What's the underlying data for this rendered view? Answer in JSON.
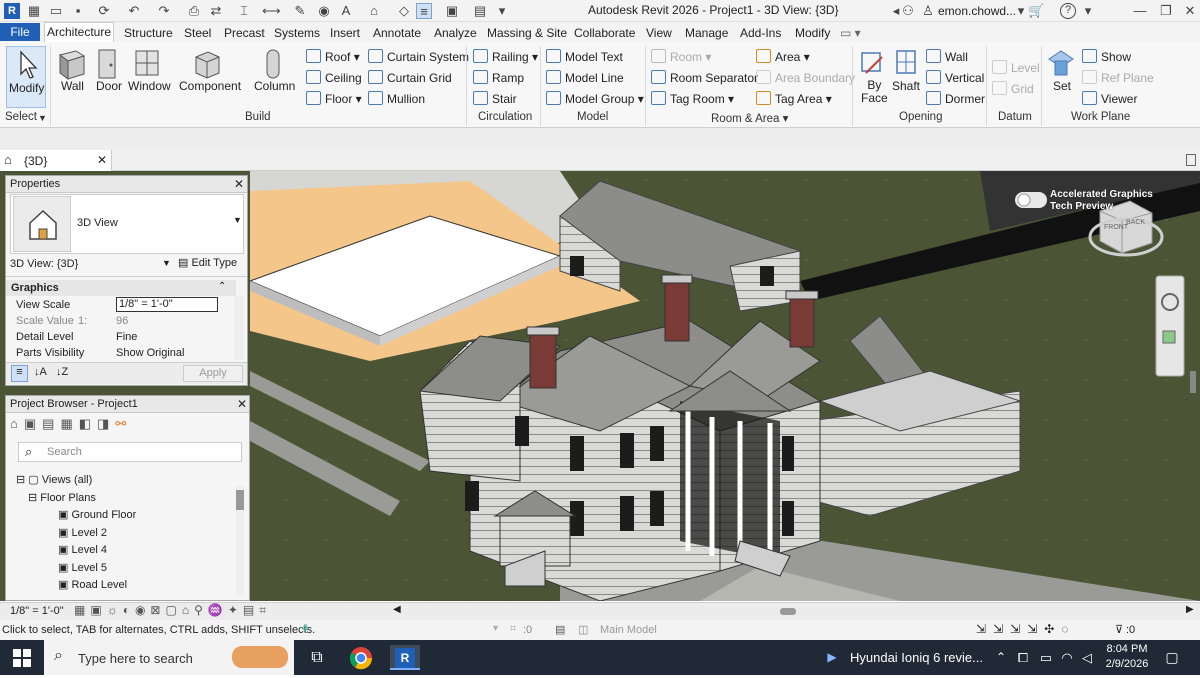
{
  "app": {
    "title": "Autodesk Revit 2026 - Project1 - 3D View: {3D}",
    "user": "emon.chowd...",
    "help": "?"
  },
  "ribbon_tabs": [
    "File",
    "Architecture",
    "Structure",
    "Steel",
    "Precast",
    "Systems",
    "Insert",
    "Annotate",
    "Analyze",
    "Massing & Site",
    "Collaborate",
    "View",
    "Manage",
    "Add-Ins",
    "Modify"
  ],
  "ribbon": {
    "select": {
      "modify": "Modify",
      "label": "Select"
    },
    "build": {
      "label": "Build",
      "big": [
        "Wall",
        "Door",
        "Window",
        "Component",
        "Column"
      ],
      "col1": [
        "Roof",
        "Ceiling",
        "Floor"
      ],
      "col2": [
        "Curtain System",
        "Curtain Grid",
        "Mullion"
      ]
    },
    "circulation": {
      "label": "Circulation",
      "items": [
        "Railing",
        "Ramp",
        "Stair"
      ]
    },
    "model": {
      "label": "Model",
      "items": [
        "Model Text",
        "Model Line",
        "Model Group"
      ]
    },
    "room_area": {
      "label": "Room & Area",
      "col1": [
        "Room",
        "Room Separator",
        "Tag Room"
      ],
      "col2": [
        "Area",
        "Area Boundary",
        "Tag Area"
      ]
    },
    "opening": {
      "label": "Opening",
      "by_face": "By Face",
      "shaft": "Shaft",
      "items": [
        "Wall",
        "Vertical",
        "Dormer"
      ]
    },
    "datum": {
      "label": "Datum",
      "items": [
        "Level",
        "Grid"
      ]
    },
    "work_plane": {
      "label": "Work Plane",
      "set": "Set",
      "items": [
        "Show",
        "Ref Plane",
        "Viewer"
      ]
    }
  },
  "view_tab": {
    "label": "{3D}"
  },
  "properties": {
    "title": "Properties",
    "type_name": "3D View",
    "selector": "3D View: {3D}",
    "edit_type": "Edit Type",
    "section": "Graphics",
    "rows": [
      {
        "name": "View Scale",
        "value": "1/8\" = 1'-0\""
      },
      {
        "name": "Scale Value",
        "value": "96",
        "prefix": "1:"
      },
      {
        "name": "Detail Level",
        "value": "Fine"
      },
      {
        "name": "Parts Visibility",
        "value": "Show Original"
      }
    ],
    "apply": "Apply"
  },
  "project_browser": {
    "title": "Project Browser - Project1",
    "search_placeholder": "Search",
    "root": "Views (all)",
    "group": "Floor Plans",
    "items": [
      "Ground Floor",
      "Level 2",
      "Level 4",
      "Level 5",
      "Road Level"
    ]
  },
  "viewport": {
    "toggle_label": "Accelerated Graphics\nTech Preview",
    "viewcube_front": "FRONT",
    "viewcube_back": "BACK"
  },
  "status": {
    "scale": "1/8\" = 1'-0\"",
    "hint": "Click to select, TAB for alternates, CTRL adds, SHIFT unselects.",
    "selected_count": ":0",
    "model": "Main Model",
    "filter_count": ":0"
  },
  "taskbar": {
    "search_placeholder": "Type here to search",
    "media": "Hyundai Ioniq 6 revie...",
    "time": "8:04 PM",
    "date": "2/9/2026"
  },
  "colors": {
    "accent": "#1f5fb5",
    "viewport_grass": "#4b5536",
    "paving": "#f5c68a"
  }
}
